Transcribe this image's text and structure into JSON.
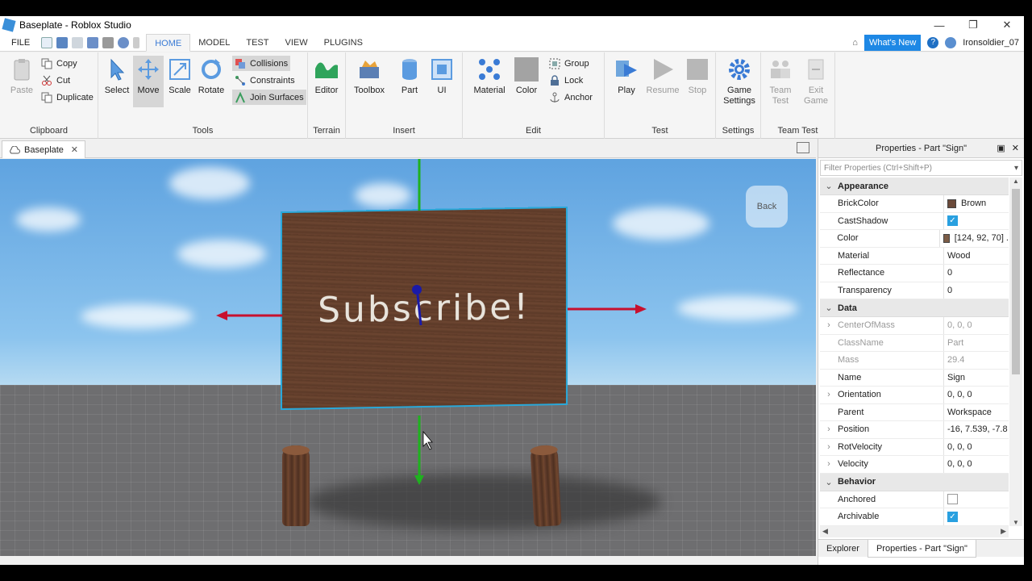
{
  "window": {
    "title": "Baseplate - Roblox Studio",
    "controls": [
      "—",
      "❐",
      "✕"
    ]
  },
  "menu": {
    "file": "FILE",
    "tabs": [
      "HOME",
      "MODEL",
      "TEST",
      "VIEW",
      "PLUGINS"
    ],
    "whats_new": "What's New",
    "username": "Ironsoldier_07"
  },
  "ribbon": {
    "clipboard": {
      "label": "Clipboard",
      "paste": "Paste",
      "copy": "Copy",
      "cut": "Cut",
      "duplicate": "Duplicate"
    },
    "tools": {
      "label": "Tools",
      "select": "Select",
      "move": "Move",
      "scale": "Scale",
      "rotate": "Rotate",
      "collisions": "Collisions",
      "constraints": "Constraints",
      "join_surfaces": "Join Surfaces"
    },
    "terrain": {
      "label": "Terrain",
      "editor": "Editor"
    },
    "insert": {
      "label": "Insert",
      "toolbox": "Toolbox",
      "part": "Part",
      "ui": "UI"
    },
    "edit": {
      "label": "Edit",
      "material": "Material",
      "color": "Color",
      "group": "Group",
      "lock": "Lock",
      "anchor": "Anchor"
    },
    "test": {
      "label": "Test",
      "play": "Play",
      "resume": "Resume",
      "stop": "Stop"
    },
    "settings": {
      "label": "Settings",
      "game_settings_1": "Game",
      "game_settings_2": "Settings"
    },
    "team_test": {
      "label": "Team Test",
      "team_1": "Team",
      "team_2": "Test",
      "exit_1": "Exit",
      "exit_2": "Game"
    }
  },
  "doc_tab": {
    "label": "Baseplate",
    "close": "✕"
  },
  "viewport": {
    "sign_text": "Subscribe!",
    "back_label": "Back"
  },
  "properties": {
    "title": "Properties - Part \"Sign\"",
    "filter_placeholder": "Filter Properties (Ctrl+Shift+P)",
    "sections": {
      "appearance": "Appearance",
      "data": "Data",
      "behavior": "Behavior"
    },
    "rows": {
      "brickcolor": {
        "name": "BrickColor",
        "value": "Brown",
        "swatch": "#6b4a3a"
      },
      "castshadow": {
        "name": "CastShadow",
        "checked": true
      },
      "color": {
        "name": "Color",
        "value": "[124, 92, 70] .",
        "swatch": "#7c5c46"
      },
      "material": {
        "name": "Material",
        "value": "Wood"
      },
      "reflectance": {
        "name": "Reflectance",
        "value": "0"
      },
      "transparency": {
        "name": "Transparency",
        "value": "0"
      },
      "centerofmass": {
        "name": "CenterOfMass",
        "value": "0, 0, 0"
      },
      "classname": {
        "name": "ClassName",
        "value": "Part"
      },
      "mass": {
        "name": "Mass",
        "value": "29.4"
      },
      "name": {
        "name": "Name",
        "value": "Sign"
      },
      "orientation": {
        "name": "Orientation",
        "value": "0, 0, 0"
      },
      "parent": {
        "name": "Parent",
        "value": "Workspace"
      },
      "position": {
        "name": "Position",
        "value": "-16, 7.539, -7.8"
      },
      "rotvelocity": {
        "name": "RotVelocity",
        "value": "0, 0, 0"
      },
      "velocity": {
        "name": "Velocity",
        "value": "0, 0, 0"
      },
      "anchored": {
        "name": "Anchored",
        "checked": false
      },
      "archivable": {
        "name": "Archivable",
        "checked": true
      }
    },
    "bottom_tabs": [
      "Explorer",
      "Properties - Part \"Sign\""
    ]
  },
  "colors": {
    "accent": "#1e88e5",
    "selection": "#29a8d9",
    "move_x": "#c8102e",
    "move_y": "#1fb11f",
    "move_z": "#1a1aa8"
  }
}
